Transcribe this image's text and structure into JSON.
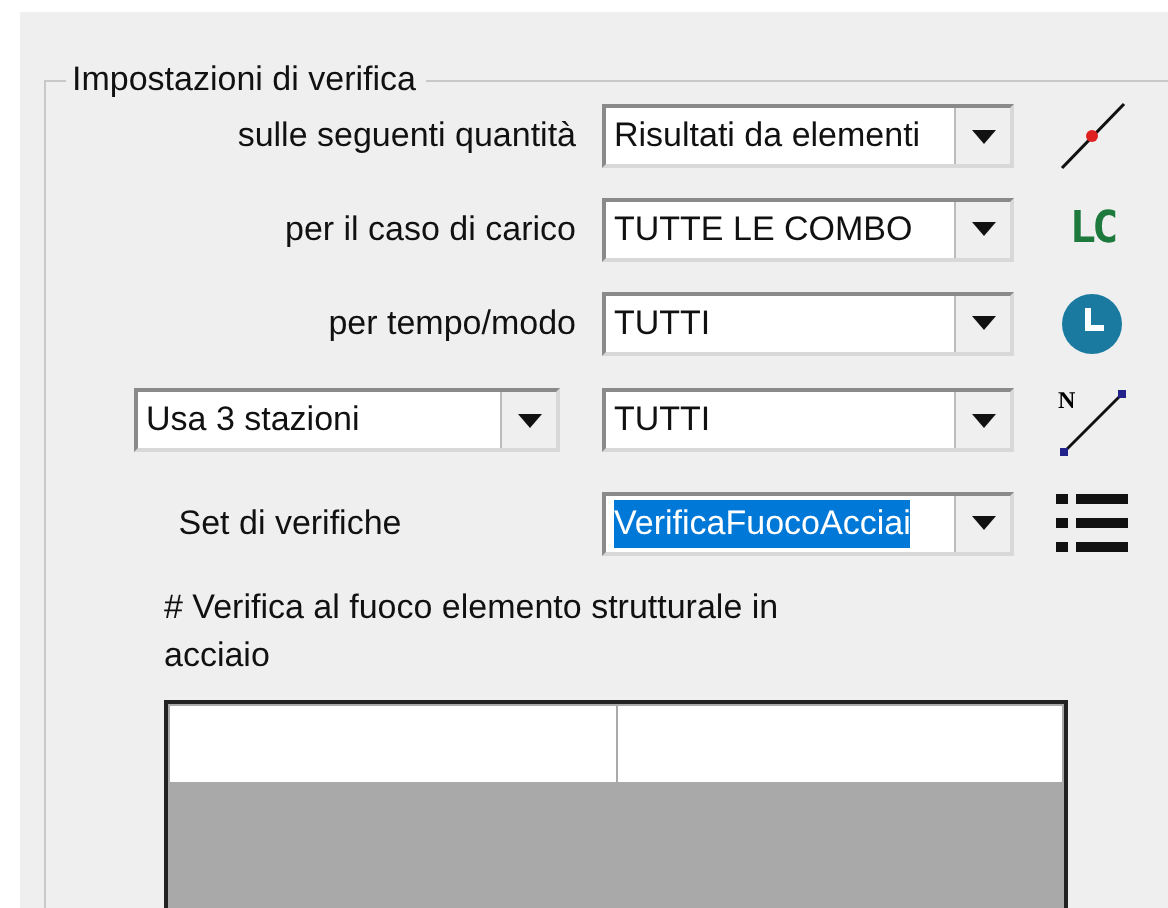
{
  "group": {
    "title": "Impostazioni di verifica"
  },
  "rows": [
    {
      "left": {
        "kind": "label",
        "text": "sulle seguenti quantità"
      },
      "combo": {
        "value": "Risultati da elementi",
        "selected": false
      },
      "icon": {
        "kind": "point-line"
      }
    },
    {
      "left": {
        "kind": "label",
        "text": "per il caso di carico"
      },
      "combo": {
        "value": "TUTTE LE COMBO",
        "selected": false
      },
      "icon": {
        "kind": "letters",
        "text": "LC"
      }
    },
    {
      "left": {
        "kind": "label",
        "text": "per tempo/modo"
      },
      "combo": {
        "value": "TUTTI",
        "selected": false
      },
      "icon": {
        "kind": "clock"
      }
    },
    {
      "left": {
        "kind": "dropdown",
        "text": "Usa 3 stazioni"
      },
      "combo": {
        "value": "TUTTI",
        "selected": false
      },
      "icon": {
        "kind": "node-line",
        "text": "N"
      }
    },
    {
      "left": {
        "kind": "label-center",
        "text": "Set di verifiche"
      },
      "combo": {
        "value": "VerificaFuocoAcciai",
        "selected": true
      },
      "icon": {
        "kind": "list"
      }
    }
  ],
  "description": "# Verifica al fuoco elemento strutturale in acciaio"
}
